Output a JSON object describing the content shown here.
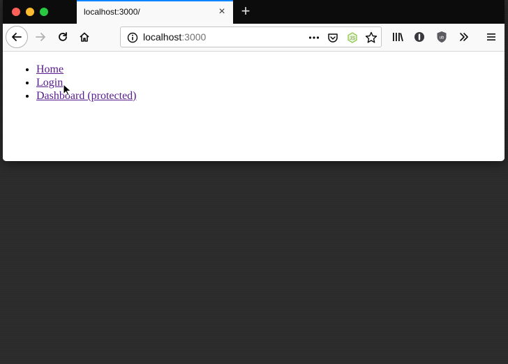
{
  "window": {
    "tab": {
      "title": "localhost:3000/",
      "close_glyph": "×"
    },
    "new_tab_glyph": "+"
  },
  "toolbar": {
    "url_host": "localhost",
    "url_port": ":3000",
    "icons": [
      "back-icon",
      "forward-icon",
      "reload-icon",
      "home-icon",
      "info-icon",
      "more-icon",
      "pocket-icon",
      "node-extension-icon",
      "bookmark-star-icon",
      "library-icon",
      "sync-icon",
      "ublock-icon",
      "overflow-icon",
      "menu-icon"
    ]
  },
  "page": {
    "links": [
      {
        "label": "Home"
      },
      {
        "label": "Login"
      },
      {
        "label": "Dashboard (protected)"
      }
    ]
  },
  "colors": {
    "tab_accent": "#0a84ff",
    "visited_link": "#551a8b",
    "tabbar_bg": "#0c0c0d",
    "toolbar_bg": "#f9f9fa"
  }
}
